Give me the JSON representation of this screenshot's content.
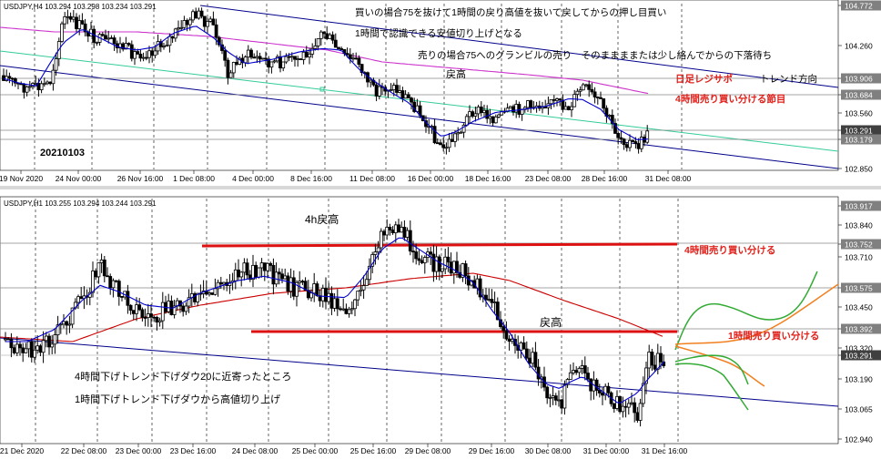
{
  "colors": {
    "background": "#ffffff",
    "candle": "#000000",
    "ma_fast": "#0000cc",
    "ma_slow_h4": "#cc33cc",
    "ma_slow_h1": "#cc0000",
    "trend_channel": "#00008b",
    "teal_line": "#33cc99",
    "level_red": "#dd1111",
    "annotation_red": "#e0201a",
    "scenario_green": "#33aa33",
    "scenario_orange": "#f08020",
    "label_gray_bg": "#808080",
    "label_text": "#ffffff"
  },
  "top_panel": {
    "symbol_header": "USDJPY,H4  103.294 103.298 103.234 103.291",
    "date_stamp": "20210103",
    "notes": [
      "買いの場合75を抜けて1時間の戻り高値を抜いて戻してからの押し目買い",
      "1時間で認識できる安値切り上げとなる",
      "売りの場合75へのグランビルの売り　そのままままたは少し絡んでからの下落待ち"
    ],
    "label_modori": "戻高",
    "label_daily_rs": "日足レジサポ",
    "label_trend_dir": "トレンド方向",
    "label_4h_split": "4時間売り買い分ける節目",
    "price_labels": [
      "104.772",
      "104.260",
      "103.906",
      "103.684",
      "103.560",
      "103.291",
      "103.179",
      "102.850"
    ],
    "time_labels": [
      "19 Nov 2020",
      "24 Nov 00:00",
      "26 Nov 16:00",
      "1 Dec 08:00",
      "4 Dec 00:00",
      "8 Dec 16:00",
      "11 Dec 08:00",
      "16 Dec 00:00",
      "18 Dec 16:00",
      "23 Dec 08:00",
      "28 Dec 16:00",
      "31 Dec 08:00"
    ]
  },
  "bottom_panel": {
    "symbol_header": "USDJPY,H1  103.255 103.294 103.244 103.291",
    "label_4h_modori": "4h戻高",
    "label_4h_split": "4時間売り買い分ける",
    "label_modori": "戻高",
    "label_1h_split": "1時間売り買い分ける",
    "notes": [
      "4時間下げトレンド下げダウ20に近寄ったところ",
      "1時間下げトレンド下げダウから高値切り上げ"
    ],
    "price_labels": [
      "103.917",
      "103.840",
      "103.752",
      "103.710",
      "103.575",
      "103.450",
      "103.392",
      "103.320",
      "103.291",
      "103.190",
      "103.065",
      "102.940"
    ],
    "time_labels": [
      "21 Dec 2020",
      "22 Dec 08:00",
      "23 Dec 00:00",
      "23 Dec 16:00",
      "24 Dec 08:00",
      "25 Dec 00:00",
      "25 Dec 16:00",
      "29 Dec 08:00",
      "29 Dec 16:00",
      "30 Dec 08:00",
      "31 Dec 00:00",
      "31 Dec 16:00"
    ]
  }
}
